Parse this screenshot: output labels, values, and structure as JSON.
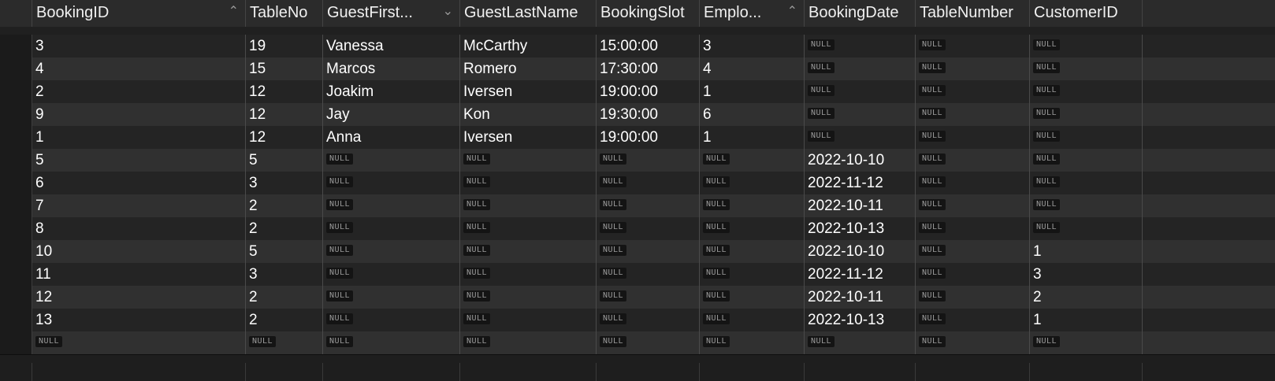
{
  "columns": [
    {
      "label": "BookingID",
      "sort_icon": "chevron-up-icon",
      "sort_glyph": "⌃"
    },
    {
      "label": "TableNo",
      "sort_icon": "",
      "sort_glyph": ""
    },
    {
      "label": "GuestFirst...",
      "sort_icon": "chevron-down-icon",
      "sort_glyph": "⌄"
    },
    {
      "label": "GuestLastName",
      "sort_icon": "",
      "sort_glyph": ""
    },
    {
      "label": "BookingSlot",
      "sort_icon": "",
      "sort_glyph": ""
    },
    {
      "label": "Emplo...",
      "sort_icon": "chevron-up-icon",
      "sort_glyph": "⌃"
    },
    {
      "label": "BookingDate",
      "sort_icon": "",
      "sort_glyph": ""
    },
    {
      "label": "TableNumber",
      "sort_icon": "",
      "sort_glyph": ""
    },
    {
      "label": "CustomerID",
      "sort_icon": "",
      "sort_glyph": ""
    }
  ],
  "null_label": "NULL",
  "rows": [
    [
      "3",
      "19",
      "Vanessa",
      "McCarthy",
      "15:00:00",
      "3",
      null,
      null,
      null
    ],
    [
      "4",
      "15",
      "Marcos",
      "Romero",
      "17:30:00",
      "4",
      null,
      null,
      null
    ],
    [
      "2",
      "12",
      "Joakim",
      "Iversen",
      "19:00:00",
      "1",
      null,
      null,
      null
    ],
    [
      "9",
      "12",
      "Jay",
      "Kon",
      "19:30:00",
      "6",
      null,
      null,
      null
    ],
    [
      "1",
      "12",
      "Anna",
      "Iversen",
      "19:00:00",
      "1",
      null,
      null,
      null
    ],
    [
      "5",
      "5",
      null,
      null,
      null,
      null,
      "2022-10-10",
      null,
      null
    ],
    [
      "6",
      "3",
      null,
      null,
      null,
      null,
      "2022-11-12",
      null,
      null
    ],
    [
      "7",
      "2",
      null,
      null,
      null,
      null,
      "2022-10-11",
      null,
      null
    ],
    [
      "8",
      "2",
      null,
      null,
      null,
      null,
      "2022-10-13",
      null,
      null
    ],
    [
      "10",
      "5",
      null,
      null,
      null,
      null,
      "2022-10-10",
      null,
      "1"
    ],
    [
      "11",
      "3",
      null,
      null,
      null,
      null,
      "2022-11-12",
      null,
      "3"
    ],
    [
      "12",
      "2",
      null,
      null,
      null,
      null,
      "2022-10-11",
      null,
      "2"
    ],
    [
      "13",
      "2",
      null,
      null,
      null,
      null,
      "2022-10-13",
      null,
      "1"
    ],
    [
      null,
      null,
      null,
      null,
      null,
      null,
      null,
      null,
      null
    ]
  ],
  "colors": {
    "background": "#1e1e1e",
    "header_bg": "#2b2b2b",
    "row_odd": "#242424",
    "row_even": "#303030",
    "null_badge_bg": "#141414",
    "null_badge_text": "#9b9b9b"
  }
}
